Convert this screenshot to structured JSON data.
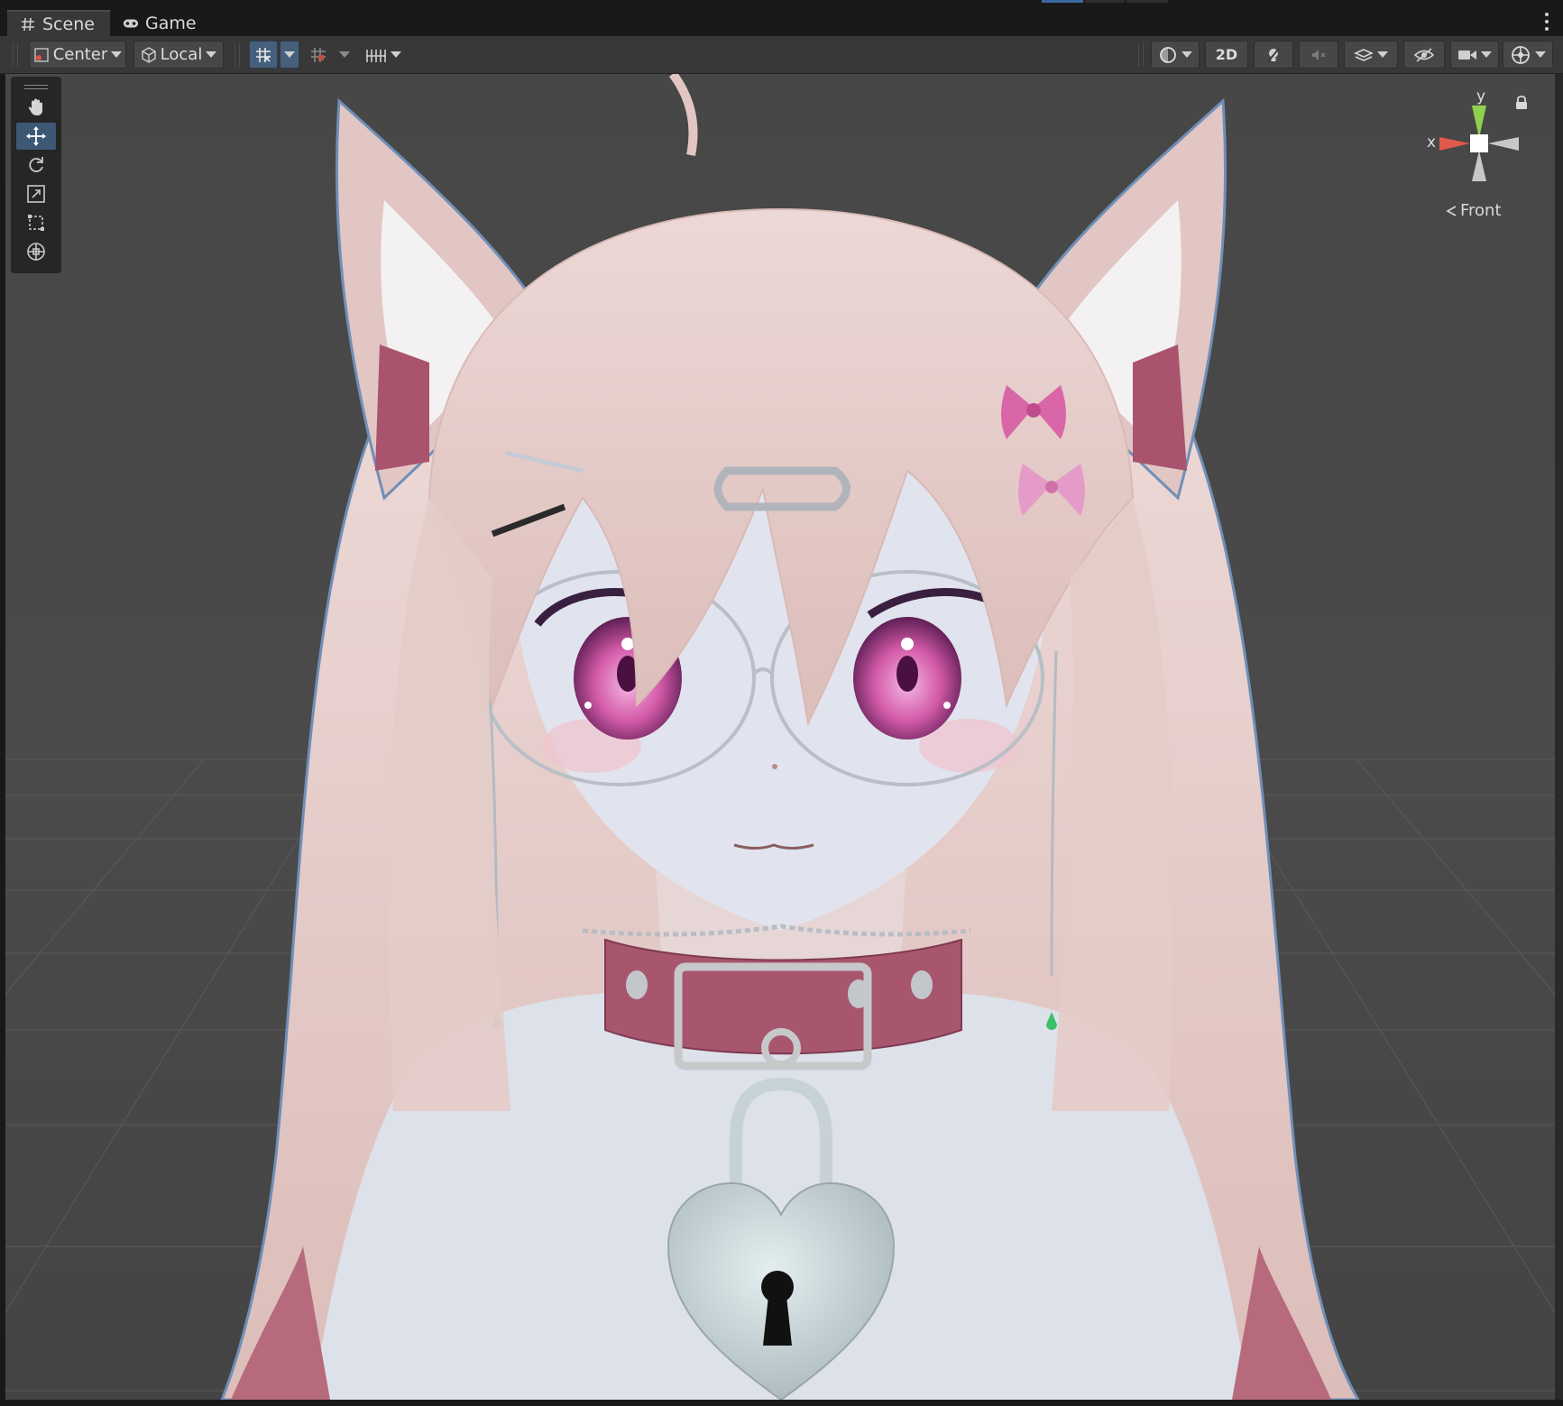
{
  "tabs": [
    {
      "label": "Scene",
      "icon": "grid-hash-icon",
      "active": true
    },
    {
      "label": "Game",
      "icon": "gamepad-icon",
      "active": false
    }
  ],
  "toolbar": {
    "pivot_mode_label": "Center",
    "pivot_rotation_label": "Local",
    "render_mode_2d_label": "2D"
  },
  "tools": [
    {
      "name": "hand-tool",
      "icon": "hand-icon",
      "active": false
    },
    {
      "name": "move-tool",
      "icon": "move-arrows-icon",
      "active": true
    },
    {
      "name": "rotate-tool",
      "icon": "rotate-icon",
      "active": false
    },
    {
      "name": "scale-tool",
      "icon": "scale-icon",
      "active": false
    },
    {
      "name": "rect-tool",
      "icon": "rect-transform-icon",
      "active": false
    },
    {
      "name": "transform-tool",
      "icon": "transform-icon",
      "active": false
    }
  ],
  "gizmo": {
    "y_label": "y",
    "x_label": "x",
    "view_label": "Front",
    "colors": {
      "x": "#e05a4a",
      "y": "#8fd14f",
      "center": "#ffffff",
      "other": "#c8c8c8"
    }
  },
  "colors": {
    "editor_bg": "#191919",
    "panel_bg": "#383838",
    "viewport_bg": "#474747",
    "selection_blue": "#46607c",
    "hair": "#e8cfcc",
    "skin": "#dfe3ec",
    "collar": "#a8566e",
    "eyes": "#d35aa8"
  }
}
